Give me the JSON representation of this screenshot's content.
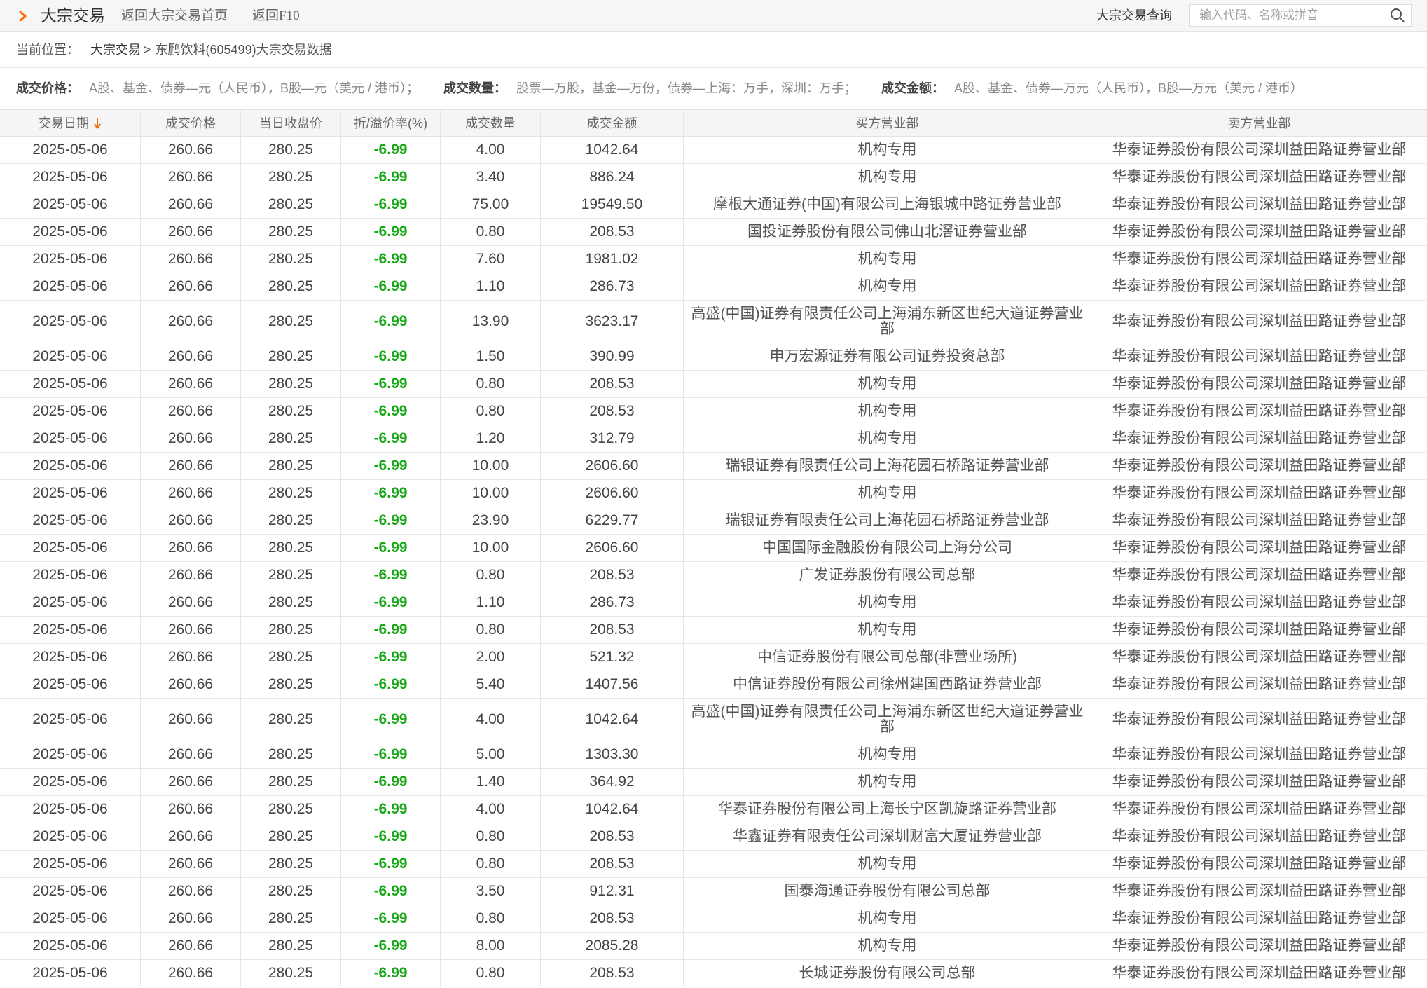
{
  "topbar": {
    "title": "大宗交易",
    "links": [
      "返回大宗交易首页",
      "返回F10"
    ],
    "query_label": "大宗交易查询",
    "search_placeholder": "输入代码、名称或拼音"
  },
  "breadcrumb": {
    "label": "当前位置：",
    "link": "大宗交易",
    "separator": ">",
    "current": "东鹏饮料(605499)大宗交易数据"
  },
  "legend": [
    {
      "label": "成交价格：",
      "text": "A股、基金、债券—元（人民币），B股—元（美元 / 港币）；"
    },
    {
      "label": "成交数量：",
      "text": "股票—万股，基金—万份，债券—上海：万手，深圳：万手；"
    },
    {
      "label": "成交金额：",
      "text": "A股、基金、债券—万元（人民币），B股—万元（美元 / 港币）"
    }
  ],
  "icons": {
    "chevron": "chevron-right-icon",
    "search": "search-icon",
    "sort": "sort-desc-icon"
  },
  "colors": {
    "accent": "#ff6a00",
    "negative": "#13a813",
    "sort_arrow": "#f07010"
  },
  "table": {
    "columns": [
      "交易日期",
      "成交价格",
      "当日收盘价",
      "折/溢价率(%)",
      "成交数量",
      "成交金额",
      "买方营业部",
      "卖方营业部"
    ],
    "rows": [
      {
        "date": "2025-05-06",
        "price": "260.66",
        "close": "280.25",
        "premium": "-6.99",
        "volume": "4.00",
        "amount": "1042.64",
        "buyer": "机构专用",
        "seller": "华泰证券股份有限公司深圳益田路证券营业部"
      },
      {
        "date": "2025-05-06",
        "price": "260.66",
        "close": "280.25",
        "premium": "-6.99",
        "volume": "3.40",
        "amount": "886.24",
        "buyer": "机构专用",
        "seller": "华泰证券股份有限公司深圳益田路证券营业部"
      },
      {
        "date": "2025-05-06",
        "price": "260.66",
        "close": "280.25",
        "premium": "-6.99",
        "volume": "75.00",
        "amount": "19549.50",
        "buyer": "摩根大通证券(中国)有限公司上海银城中路证券营业部",
        "seller": "华泰证券股份有限公司深圳益田路证券营业部"
      },
      {
        "date": "2025-05-06",
        "price": "260.66",
        "close": "280.25",
        "premium": "-6.99",
        "volume": "0.80",
        "amount": "208.53",
        "buyer": "国投证券股份有限公司佛山北滘证券营业部",
        "seller": "华泰证券股份有限公司深圳益田路证券营业部"
      },
      {
        "date": "2025-05-06",
        "price": "260.66",
        "close": "280.25",
        "premium": "-6.99",
        "volume": "7.60",
        "amount": "1981.02",
        "buyer": "机构专用",
        "seller": "华泰证券股份有限公司深圳益田路证券营业部"
      },
      {
        "date": "2025-05-06",
        "price": "260.66",
        "close": "280.25",
        "premium": "-6.99",
        "volume": "1.10",
        "amount": "286.73",
        "buyer": "机构专用",
        "seller": "华泰证券股份有限公司深圳益田路证券营业部"
      },
      {
        "date": "2025-05-06",
        "price": "260.66",
        "close": "280.25",
        "premium": "-6.99",
        "volume": "13.90",
        "amount": "3623.17",
        "buyer": "高盛(中国)证券有限责任公司上海浦东新区世纪大道证券营业部",
        "seller": "华泰证券股份有限公司深圳益田路证券营业部"
      },
      {
        "date": "2025-05-06",
        "price": "260.66",
        "close": "280.25",
        "premium": "-6.99",
        "volume": "1.50",
        "amount": "390.99",
        "buyer": "申万宏源证券有限公司证券投资总部",
        "seller": "华泰证券股份有限公司深圳益田路证券营业部"
      },
      {
        "date": "2025-05-06",
        "price": "260.66",
        "close": "280.25",
        "premium": "-6.99",
        "volume": "0.80",
        "amount": "208.53",
        "buyer": "机构专用",
        "seller": "华泰证券股份有限公司深圳益田路证券营业部"
      },
      {
        "date": "2025-05-06",
        "price": "260.66",
        "close": "280.25",
        "premium": "-6.99",
        "volume": "0.80",
        "amount": "208.53",
        "buyer": "机构专用",
        "seller": "华泰证券股份有限公司深圳益田路证券营业部"
      },
      {
        "date": "2025-05-06",
        "price": "260.66",
        "close": "280.25",
        "premium": "-6.99",
        "volume": "1.20",
        "amount": "312.79",
        "buyer": "机构专用",
        "seller": "华泰证券股份有限公司深圳益田路证券营业部"
      },
      {
        "date": "2025-05-06",
        "price": "260.66",
        "close": "280.25",
        "premium": "-6.99",
        "volume": "10.00",
        "amount": "2606.60",
        "buyer": "瑞银证券有限责任公司上海花园石桥路证券营业部",
        "seller": "华泰证券股份有限公司深圳益田路证券营业部"
      },
      {
        "date": "2025-05-06",
        "price": "260.66",
        "close": "280.25",
        "premium": "-6.99",
        "volume": "10.00",
        "amount": "2606.60",
        "buyer": "机构专用",
        "seller": "华泰证券股份有限公司深圳益田路证券营业部"
      },
      {
        "date": "2025-05-06",
        "price": "260.66",
        "close": "280.25",
        "premium": "-6.99",
        "volume": "23.90",
        "amount": "6229.77",
        "buyer": "瑞银证券有限责任公司上海花园石桥路证券营业部",
        "seller": "华泰证券股份有限公司深圳益田路证券营业部"
      },
      {
        "date": "2025-05-06",
        "price": "260.66",
        "close": "280.25",
        "premium": "-6.99",
        "volume": "10.00",
        "amount": "2606.60",
        "buyer": "中国国际金融股份有限公司上海分公司",
        "seller": "华泰证券股份有限公司深圳益田路证券营业部"
      },
      {
        "date": "2025-05-06",
        "price": "260.66",
        "close": "280.25",
        "premium": "-6.99",
        "volume": "0.80",
        "amount": "208.53",
        "buyer": "广发证券股份有限公司总部",
        "seller": "华泰证券股份有限公司深圳益田路证券营业部"
      },
      {
        "date": "2025-05-06",
        "price": "260.66",
        "close": "280.25",
        "premium": "-6.99",
        "volume": "1.10",
        "amount": "286.73",
        "buyer": "机构专用",
        "seller": "华泰证券股份有限公司深圳益田路证券营业部"
      },
      {
        "date": "2025-05-06",
        "price": "260.66",
        "close": "280.25",
        "premium": "-6.99",
        "volume": "0.80",
        "amount": "208.53",
        "buyer": "机构专用",
        "seller": "华泰证券股份有限公司深圳益田路证券营业部"
      },
      {
        "date": "2025-05-06",
        "price": "260.66",
        "close": "280.25",
        "premium": "-6.99",
        "volume": "2.00",
        "amount": "521.32",
        "buyer": "中信证券股份有限公司总部(非营业场所)",
        "seller": "华泰证券股份有限公司深圳益田路证券营业部"
      },
      {
        "date": "2025-05-06",
        "price": "260.66",
        "close": "280.25",
        "premium": "-6.99",
        "volume": "5.40",
        "amount": "1407.56",
        "buyer": "中信证券股份有限公司徐州建国西路证券营业部",
        "seller": "华泰证券股份有限公司深圳益田路证券营业部"
      },
      {
        "date": "2025-05-06",
        "price": "260.66",
        "close": "280.25",
        "premium": "-6.99",
        "volume": "4.00",
        "amount": "1042.64",
        "buyer": "高盛(中国)证券有限责任公司上海浦东新区世纪大道证券营业部",
        "seller": "华泰证券股份有限公司深圳益田路证券营业部"
      },
      {
        "date": "2025-05-06",
        "price": "260.66",
        "close": "280.25",
        "premium": "-6.99",
        "volume": "5.00",
        "amount": "1303.30",
        "buyer": "机构专用",
        "seller": "华泰证券股份有限公司深圳益田路证券营业部"
      },
      {
        "date": "2025-05-06",
        "price": "260.66",
        "close": "280.25",
        "premium": "-6.99",
        "volume": "1.40",
        "amount": "364.92",
        "buyer": "机构专用",
        "seller": "华泰证券股份有限公司深圳益田路证券营业部"
      },
      {
        "date": "2025-05-06",
        "price": "260.66",
        "close": "280.25",
        "premium": "-6.99",
        "volume": "4.00",
        "amount": "1042.64",
        "buyer": "华泰证券股份有限公司上海长宁区凯旋路证券营业部",
        "seller": "华泰证券股份有限公司深圳益田路证券营业部"
      },
      {
        "date": "2025-05-06",
        "price": "260.66",
        "close": "280.25",
        "premium": "-6.99",
        "volume": "0.80",
        "amount": "208.53",
        "buyer": "华鑫证券有限责任公司深圳财富大厦证券营业部",
        "seller": "华泰证券股份有限公司深圳益田路证券营业部"
      },
      {
        "date": "2025-05-06",
        "price": "260.66",
        "close": "280.25",
        "premium": "-6.99",
        "volume": "0.80",
        "amount": "208.53",
        "buyer": "机构专用",
        "seller": "华泰证券股份有限公司深圳益田路证券营业部"
      },
      {
        "date": "2025-05-06",
        "price": "260.66",
        "close": "280.25",
        "premium": "-6.99",
        "volume": "3.50",
        "amount": "912.31",
        "buyer": "国泰海通证券股份有限公司总部",
        "seller": "华泰证券股份有限公司深圳益田路证券营业部"
      },
      {
        "date": "2025-05-06",
        "price": "260.66",
        "close": "280.25",
        "premium": "-6.99",
        "volume": "0.80",
        "amount": "208.53",
        "buyer": "机构专用",
        "seller": "华泰证券股份有限公司深圳益田路证券营业部"
      },
      {
        "date": "2025-05-06",
        "price": "260.66",
        "close": "280.25",
        "premium": "-6.99",
        "volume": "8.00",
        "amount": "2085.28",
        "buyer": "机构专用",
        "seller": "华泰证券股份有限公司深圳益田路证券营业部"
      },
      {
        "date": "2025-05-06",
        "price": "260.66",
        "close": "280.25",
        "premium": "-6.99",
        "volume": "0.80",
        "amount": "208.53",
        "buyer": "长城证券股份有限公司总部",
        "seller": "华泰证券股份有限公司深圳益田路证券营业部"
      }
    ]
  }
}
